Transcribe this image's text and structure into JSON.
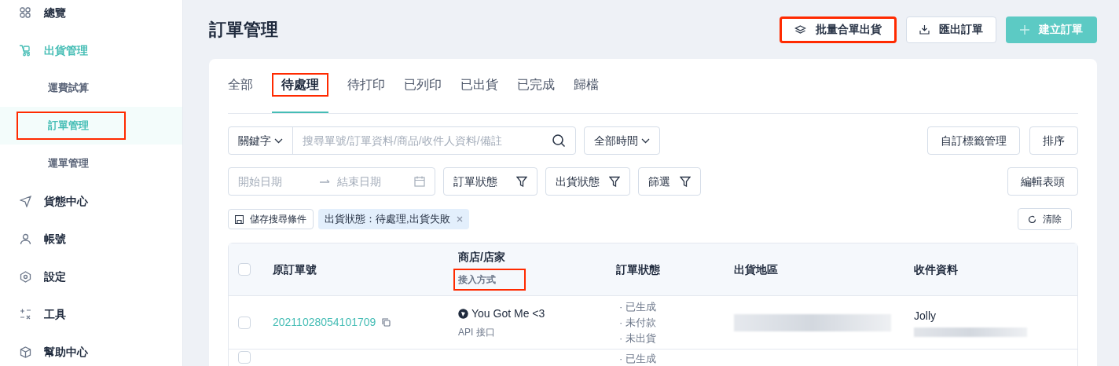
{
  "sidebar": {
    "items": [
      {
        "label": "總覽",
        "selected": false
      },
      {
        "label": "出貨管理",
        "selected": true,
        "children": [
          {
            "label": "運費試算",
            "selected": false,
            "highlighted": false
          },
          {
            "label": "訂單管理",
            "selected": true,
            "highlighted": true
          },
          {
            "label": "運單管理",
            "selected": false,
            "highlighted": false
          }
        ]
      },
      {
        "label": "貨態中心",
        "selected": false
      },
      {
        "label": "帳號",
        "selected": false
      },
      {
        "label": "設定",
        "selected": false
      },
      {
        "label": "工具",
        "selected": false
      },
      {
        "label": "幫助中心",
        "selected": false
      }
    ]
  },
  "page_title": "訂單管理",
  "toolbar": [
    {
      "label": "批量合單出貨",
      "kind": "default",
      "highlighted": true
    },
    {
      "label": "匯出訂單",
      "kind": "export",
      "highlighted": false
    },
    {
      "label": "建立訂單",
      "kind": "primary",
      "highlighted": false
    }
  ],
  "tabs": [
    {
      "label": "全部",
      "selected": false,
      "highlighted": false
    },
    {
      "label": "待處理",
      "selected": true,
      "highlighted": true
    },
    {
      "label": "待打印",
      "selected": false,
      "highlighted": false
    },
    {
      "label": "已列印",
      "selected": false,
      "highlighted": false
    },
    {
      "label": "已出貨",
      "selected": false,
      "highlighted": false
    },
    {
      "label": "已完成",
      "selected": false,
      "highlighted": false
    },
    {
      "label": "歸檔",
      "selected": false,
      "highlighted": false
    }
  ],
  "filters": {
    "keyword_select": "關鍵字",
    "search": {
      "placeholder": "搜尋單號/訂單資料/商品/收件人資料/備註"
    },
    "time_select": "全部時間",
    "right_buttons": [
      "自訂標籤管理",
      "排序"
    ],
    "date_range": {
      "start_placeholder": "開始日期",
      "end_placeholder": "結束日期"
    },
    "filter_buttons": [
      "訂單狀態",
      "出貨狀態",
      "篩選"
    ],
    "edit_header_button": "編輯表頭",
    "save_search_button": "儲存搜尋條件",
    "active_filters": [
      {
        "label": "出貨狀態：待處理,出貨失敗"
      }
    ],
    "clear_button": "清除"
  },
  "table": {
    "select_all_checked": false,
    "columns": [
      {
        "label": "原訂單號"
      },
      {
        "label": "商店/店家",
        "subtitle": "接入方式",
        "subtitle_highlighted": true
      },
      {
        "label": "訂單狀態"
      },
      {
        "label": "出貨地區"
      },
      {
        "label": "收件資料"
      }
    ],
    "rows": [
      {
        "checked": false,
        "order_number": "20211028054101709",
        "store": "You Got Me <3",
        "integration": "API 接口",
        "statuses": [
          "· 已生成",
          "· 未付款",
          "· 未出貨"
        ],
        "recipient_name": "Jolly"
      },
      {
        "checked": false,
        "statuses": [
          "· 已生成"
        ]
      }
    ]
  }
}
